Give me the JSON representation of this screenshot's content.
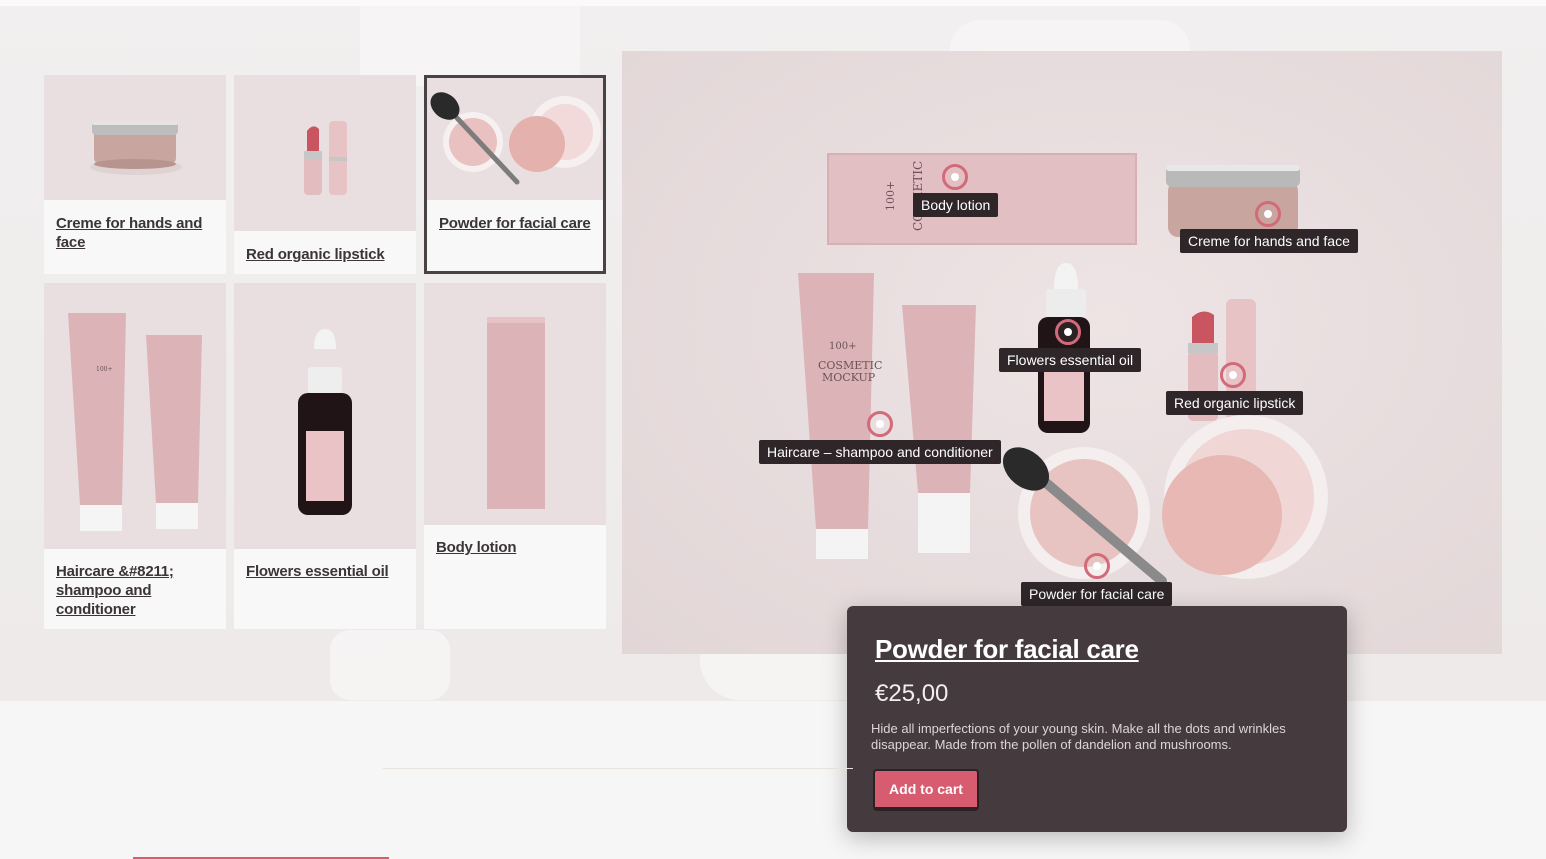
{
  "grid": {
    "products": [
      {
        "name": "Creme for hands and face",
        "icon": "cream-jar-icon"
      },
      {
        "name": "Red organic lipstick",
        "icon": "lipstick-icon"
      },
      {
        "name": "Powder for facial care",
        "icon": "powder-brush-icon",
        "selected": true
      },
      {
        "name": "Haircare &#8211; shampoo and conditioner",
        "icon": "tube-icon"
      },
      {
        "name": "Flowers essential oil",
        "icon": "dropper-bottle-icon"
      },
      {
        "name": "Body lotion",
        "icon": "lotion-box-icon"
      }
    ]
  },
  "showcase": {
    "tags": {
      "body_lotion": "Body lotion",
      "creme": "Creme for hands and face",
      "oil": "Flowers essential oil",
      "lipstick": "Red organic lipstick",
      "haircare": "Haircare – shampoo and conditioner",
      "powder": "Powder for facial care"
    },
    "packaging_text": {
      "brand": "100+",
      "line1": "COSMETIC",
      "line2": "MOCKUP"
    }
  },
  "popup": {
    "title": "Powder for facial care",
    "price": "€25,00",
    "description": "Hide all imperfections of your young skin. Make all the dots and wrinkles disappear. Made from the pollen of dandelion and mushrooms.",
    "button": "Add to cart"
  },
  "colors": {
    "accent": "#d85c6f",
    "popup_bg": "#453b3e",
    "tag_bg": "#2e2628",
    "product_pink": "#e7c3c5"
  }
}
